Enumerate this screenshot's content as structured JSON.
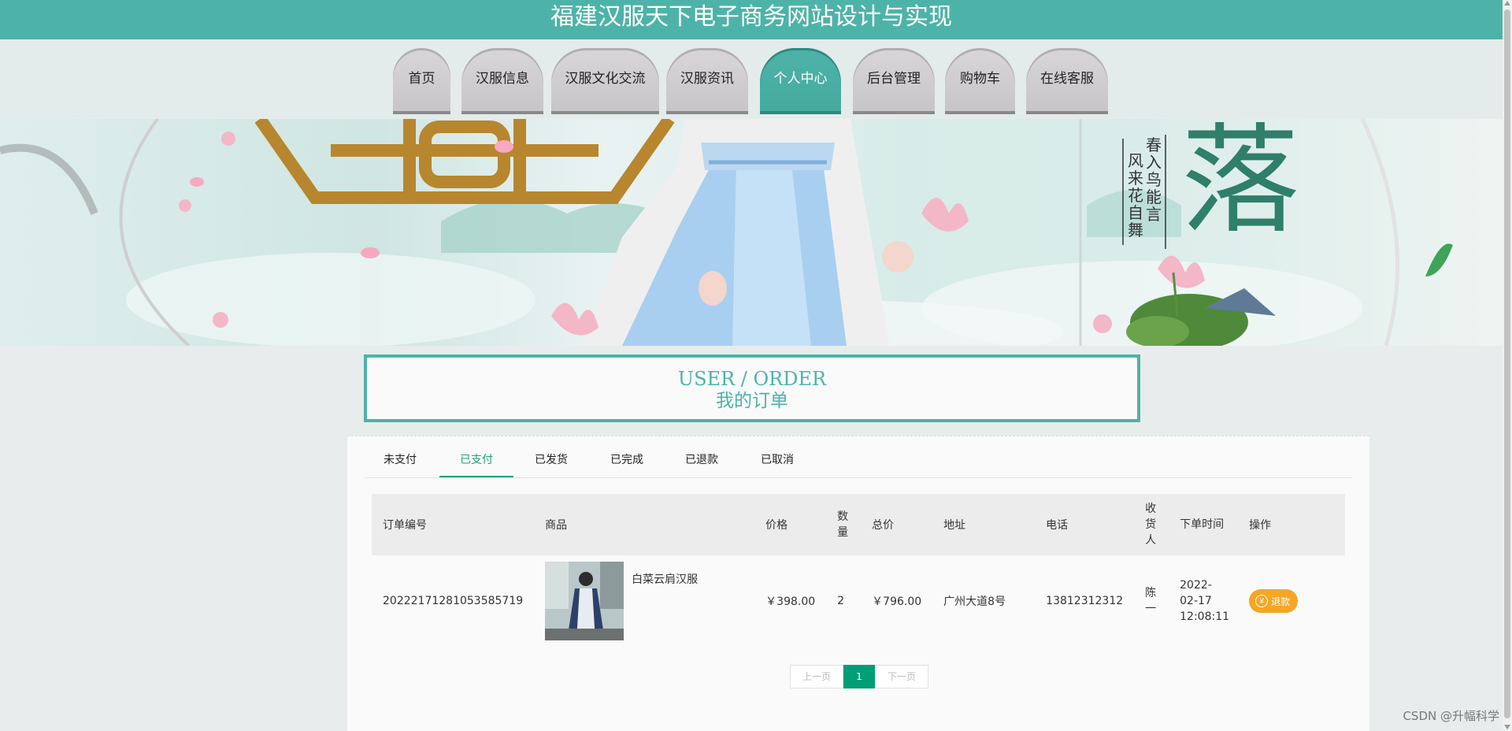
{
  "site_title": "福建汉服天下电子商务网站设计与实现",
  "nav": [
    {
      "label": "首页"
    },
    {
      "label": "汉服信息"
    },
    {
      "label": "汉服文化交流"
    },
    {
      "label": "汉服资讯"
    },
    {
      "label": "个人中心",
      "active": true
    },
    {
      "label": "后台管理"
    },
    {
      "label": "购物车"
    },
    {
      "label": "在线客服"
    }
  ],
  "banner": {
    "calligraphy_big": "落",
    "poem": "春入鸟能言 风来花自舞"
  },
  "section": {
    "en": "USER / ORDER",
    "zh": "我的订单"
  },
  "order_tabs": [
    {
      "label": "未支付"
    },
    {
      "label": "已支付",
      "active": true
    },
    {
      "label": "已发货"
    },
    {
      "label": "已完成"
    },
    {
      "label": "已退款"
    },
    {
      "label": "已取消"
    }
  ],
  "table": {
    "headers": [
      "订单编号",
      "商品",
      "价格",
      "数量",
      "总价",
      "地址",
      "电话",
      "收货人",
      "下单时间",
      "操作"
    ],
    "rows": [
      {
        "order_no": "20222171281053585719",
        "product": "白菜云肩汉服",
        "price": "￥398.00",
        "qty": "2",
        "total": "￥796.00",
        "address": "广州大道8号",
        "phone": "13812312312",
        "receiver": "陈一",
        "time": "2022-02-17 12:08:11",
        "action": "退款"
      }
    ]
  },
  "pager": {
    "prev": "上一页",
    "current": "1",
    "next": "下一页"
  },
  "watermark": "CSDN @升幅科学",
  "colors": {
    "accent": "#4db3a8",
    "tab_active": "#1aa37a",
    "refund": "#f5a623",
    "pager_active": "#009e75"
  }
}
